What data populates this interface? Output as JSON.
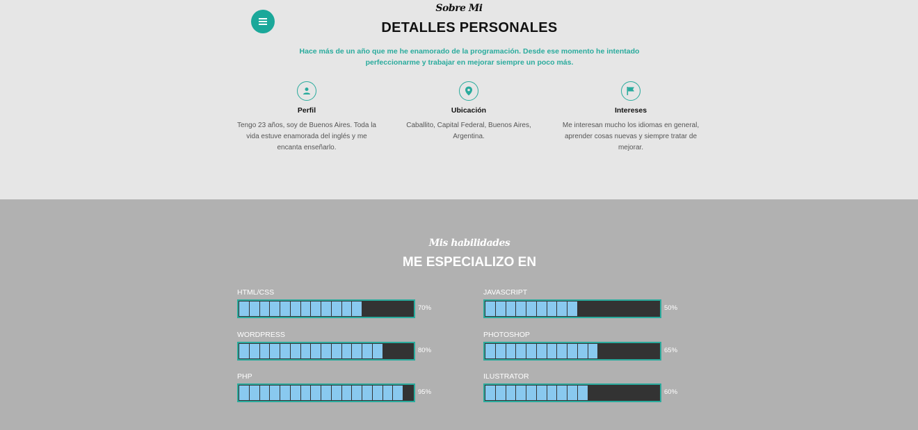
{
  "about": {
    "script_title": "Sobre Mi",
    "title": "DETALLES PERSONALES",
    "intro": "Hace más de un año que me he enamorado de la programación. Desde ese momento he intentado perfeccionarme y trabajar en mejorar siempre un poco más.",
    "columns": [
      {
        "icon": "user-icon",
        "title": "Perfil",
        "text": "Tengo 23 años, soy de Buenos Aires. Toda la vida estuve enamorada del inglés y me encanta enseñarlo."
      },
      {
        "icon": "location-pin-icon",
        "title": "Ubicación",
        "text": "Caballito, Capital Federal, Buenos Aires, Argentina."
      },
      {
        "icon": "flag-icon",
        "title": "Intereses",
        "text": "Me interesan mucho los idiomas en general, aprender cosas nuevas y siempre tratar de mejorar."
      }
    ]
  },
  "skills": {
    "script_title": "Mis habilidades",
    "title": "ME ESPECIALIZO EN",
    "items": [
      {
        "name": "HTML/CSS",
        "percent_label": "70%",
        "filled": 0.7
      },
      {
        "name": "JAVASCRIPT",
        "percent_label": "50%",
        "filled": 0.5
      },
      {
        "name": "WORDPRESS",
        "percent_label": "80%",
        "filled": 0.8
      },
      {
        "name": "PHOTOSHOP",
        "percent_label": "65%",
        "filled": 0.65
      },
      {
        "name": "PHP",
        "percent_label": "95%",
        "filled": 0.95
      },
      {
        "name": "ILUSTRATOR",
        "percent_label": "60%",
        "filled": 0.6
      }
    ]
  },
  "menu": {
    "icon": "hamburger-icon"
  },
  "colors": {
    "accent": "#2aab9d",
    "bar_fill": "#89c9ef",
    "bar_empty": "#333333",
    "top_bg": "#e6e6e6",
    "bottom_bg": "#b1b1b1"
  }
}
